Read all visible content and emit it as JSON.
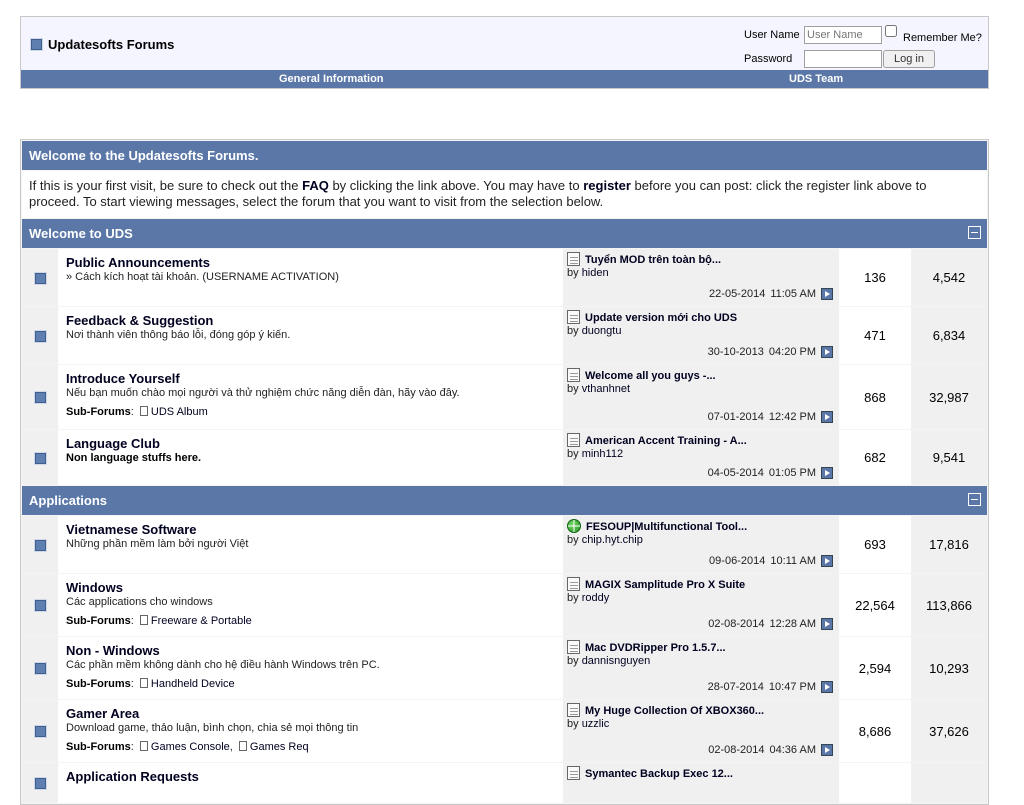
{
  "header": {
    "site_title": "Updatesofts Forums",
    "login": {
      "username_label": "User Name",
      "username_placeholder": "User Name",
      "password_label": "Password",
      "remember_label": "Remember Me?",
      "login_button": "Log in"
    },
    "nav": {
      "general_information": "General Information",
      "uds_team": "UDS Team"
    }
  },
  "welcome": {
    "title": "Welcome to the Updatesofts Forums.",
    "text_1": "If this is your first visit, be sure to check out the ",
    "faq": "FAQ",
    "text_2": " by clicking the link above. You may have to ",
    "register": "register",
    "text_3": " before you can post: click the register link above to proceed. To start viewing messages, select the forum that you want to visit from the selection below."
  },
  "by_label": "by",
  "subforums_label": "Sub-Forums",
  "categories": [
    {
      "title": "Welcome to UDS",
      "forums": [
        {
          "title": "Public Announcements",
          "desc": "» Cách kích hoạt tài khoản. (USERNAME ACTIVATION)",
          "last_title": "Tuyển MOD trên toàn bộ...",
          "last_by": "hiden",
          "last_date": "22-05-2014",
          "last_time": "11:05 AM",
          "threads": "136",
          "posts": "4,542"
        },
        {
          "title": "Feedback & Suggestion",
          "desc": "Nơi thành viên thông báo lỗi, đóng góp ý kiến.",
          "last_title": "Update version mới cho UDS",
          "last_by": "duongtu",
          "last_date": "30-10-2013",
          "last_time": "04:20 PM",
          "threads": "471",
          "posts": "6,834"
        },
        {
          "title": "Introduce Yourself",
          "desc": "Nếu bạn muốn chào mọi người và thử nghiệm chức năng diễn đàn, hãy vào đây.",
          "sub": [
            "UDS Album"
          ],
          "last_title": "Welcome all you guys -...",
          "last_by": "vthanhnet",
          "last_date": "07-01-2014",
          "last_time": "12:42 PM",
          "threads": "868",
          "posts": "32,987"
        },
        {
          "title": "Language Club",
          "desc": "Non language stuffs here.",
          "desc_bold": true,
          "last_title": "American Accent Training - A...",
          "last_by": "minh112",
          "last_date": "04-05-2014",
          "last_time": "01:05 PM",
          "threads": "682",
          "posts": "9,541"
        }
      ]
    },
    {
      "title": "Applications",
      "forums": [
        {
          "title": "Vietnamese Software",
          "desc": "Những phần mềm làm bởi người Việt",
          "last_title": "FESOUP|Multifunctional Tool...",
          "last_icon": "globe",
          "last_by": "chip.hyt.chip",
          "last_date": "09-06-2014",
          "last_time": "10:11 AM",
          "threads": "693",
          "posts": "17,816"
        },
        {
          "title": "Windows",
          "desc": "Các applications cho windows",
          "sub": [
            "Freeware & Portable"
          ],
          "last_title": "MAGIX Samplitude Pro X Suite",
          "last_by": "roddy",
          "last_date": "02-08-2014",
          "last_time": "12:28 AM",
          "threads": "22,564",
          "posts": "113,866"
        },
        {
          "title": "Non - Windows",
          "desc": "Các phần mềm không dành cho hệ điều hành Windows trên PC.",
          "sub": [
            "Handheld Device"
          ],
          "last_title": "Mac DVDRipper Pro 1.5.7...",
          "last_by": "dannisnguyen",
          "last_date": "28-07-2014",
          "last_time": "10:47 PM",
          "threads": "2,594",
          "posts": "10,293"
        },
        {
          "title": "Gamer Area",
          "desc": "Download game, thảo luận, bình chọn, chia sẻ mọi thông tin",
          "sub": [
            "Games Console",
            "Games Req"
          ],
          "last_title": "My Huge Collection Of XBOX360...",
          "last_by": "uzzlic",
          "last_date": "02-08-2014",
          "last_time": "04:36 AM",
          "threads": "8,686",
          "posts": "37,626"
        },
        {
          "title": "Application Requests",
          "desc": "",
          "last_title": "Symantec Backup Exec 12...",
          "last_by": "",
          "last_date": "",
          "last_time": "",
          "threads": "",
          "posts": ""
        }
      ]
    }
  ]
}
